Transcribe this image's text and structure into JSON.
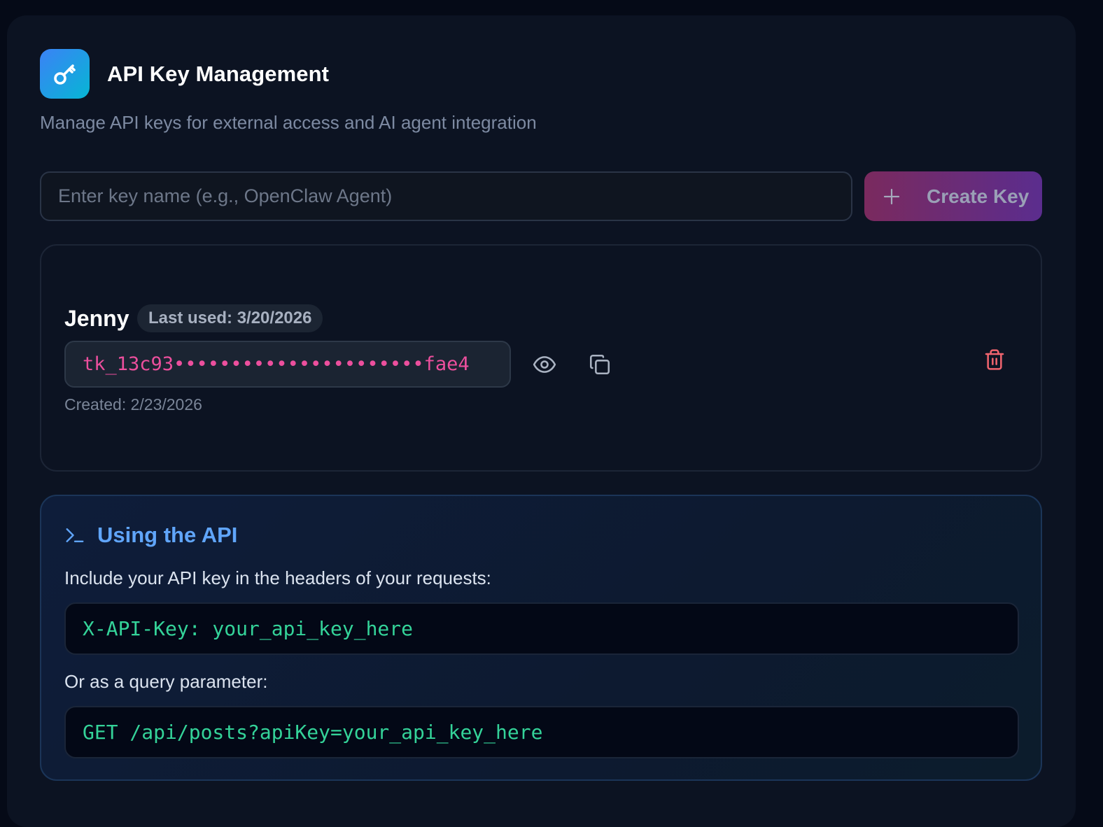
{
  "header": {
    "title": "API Key Management",
    "subtitle": "Manage API keys for external access and AI agent integration",
    "icon": "key-icon"
  },
  "create": {
    "input_value": "",
    "input_placeholder": "Enter key name (e.g., OpenClaw Agent)",
    "button_label": "Create Key",
    "button_icon": "plus-icon"
  },
  "keys": [
    {
      "name": "Jenny",
      "last_used": "Last used: 3/20/2026",
      "masked_key": "tk_13c93••••••••••••••••••••••fae4",
      "created": "Created: 2/23/2026",
      "actions": [
        "eye-icon",
        "copy-icon",
        "trash-icon"
      ]
    }
  ],
  "usage": {
    "heading": "Using the API",
    "header_instruction": "Include your API key in the headers of your requests:",
    "header_code": "X-API-Key: your_api_key_here",
    "query_instruction": "Or as a query parameter:",
    "query_code": "GET /api/posts?apiKey=your_api_key_here"
  },
  "colors": {
    "page_bg": "#050a17",
    "panel_bg": "#0c1322",
    "accent_blue": "#60a5fa",
    "key_pink": "#ec4f9d",
    "code_green": "#34d399",
    "danger_red": "#f0646e",
    "create_gradient_start": "#7a2a5e",
    "create_gradient_end": "#5b2d8e"
  }
}
